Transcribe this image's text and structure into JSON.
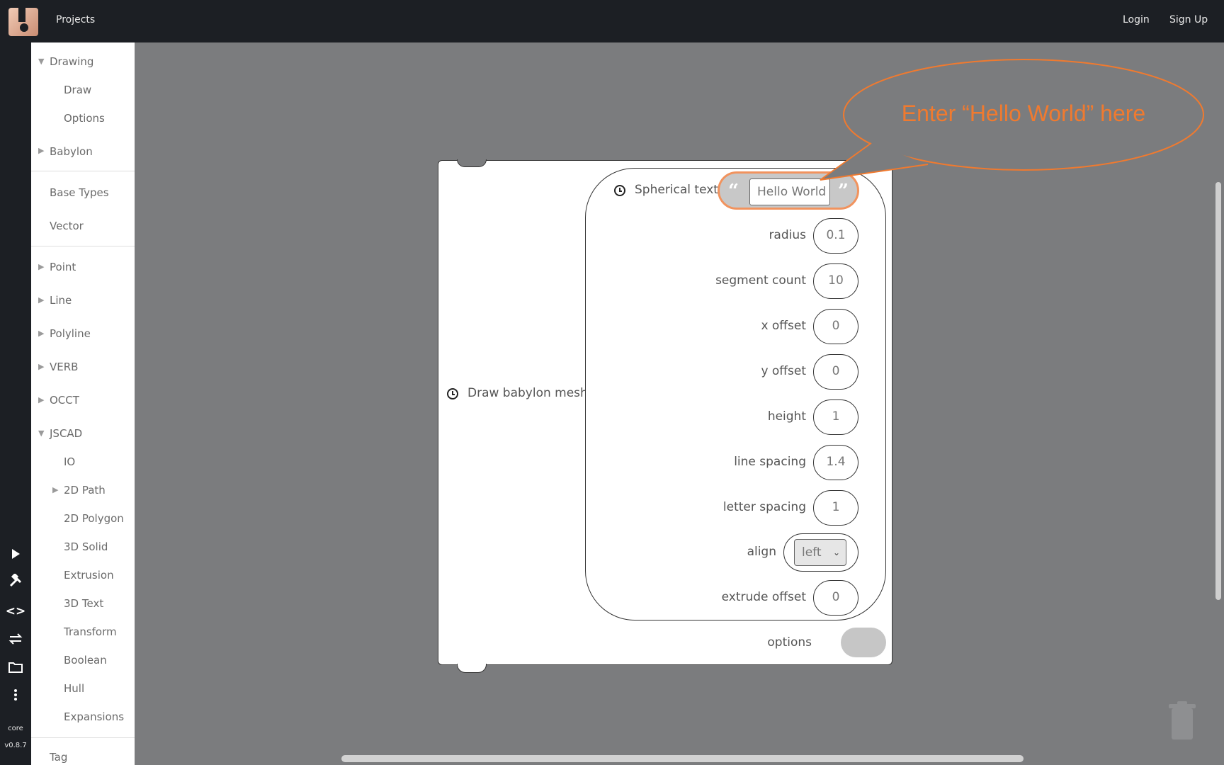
{
  "topbar": {
    "nav_projects": "Projects",
    "login": "Login",
    "signup": "Sign Up"
  },
  "rail": {
    "icons": [
      "play-icon",
      "tools-icon",
      "code-icon",
      "swap-icon",
      "folder-icon",
      "more-icon"
    ],
    "core": "core",
    "version": "v0.8.7"
  },
  "toolbox": {
    "items": [
      {
        "label": "Drawing",
        "expanded": true
      },
      {
        "label": "Draw"
      },
      {
        "label": "Options"
      },
      {
        "label": "Babylon",
        "expanded": false
      },
      {
        "label": "Base Types"
      },
      {
        "label": "Vector"
      },
      {
        "label": "Point",
        "expanded": false
      },
      {
        "label": "Line",
        "expanded": false
      },
      {
        "label": "Polyline",
        "expanded": false
      },
      {
        "label": "VERB",
        "expanded": false
      },
      {
        "label": "OCCT",
        "expanded": false
      },
      {
        "label": "JSCAD",
        "expanded": true
      },
      {
        "label": "IO"
      },
      {
        "label": "2D Path",
        "expanded": false
      },
      {
        "label": "2D Polygon"
      },
      {
        "label": "3D Solid"
      },
      {
        "label": "Extrusion"
      },
      {
        "label": "3D Text"
      },
      {
        "label": "Transform"
      },
      {
        "label": "Boolean"
      },
      {
        "label": "Hull"
      },
      {
        "label": "Expansions"
      },
      {
        "label": "Tag"
      }
    ]
  },
  "block": {
    "outer_label": "Draw babylon mesh",
    "inner_label": "Spherical text",
    "text_value": "Hello World",
    "params": [
      {
        "label": "radius",
        "value": "0.1"
      },
      {
        "label": "segment count",
        "value": "10"
      },
      {
        "label": "x offset",
        "value": "0"
      },
      {
        "label": "y offset",
        "value": "0"
      },
      {
        "label": "height",
        "value": "1"
      },
      {
        "label": "line spacing",
        "value": "1.4"
      },
      {
        "label": "letter spacing",
        "value": "1"
      },
      {
        "label": "align",
        "value": "left"
      },
      {
        "label": "extrude offset",
        "value": "0"
      }
    ],
    "options_label": "options"
  },
  "callout": {
    "text": "Enter “Hello World” here",
    "color": "#f07a2f"
  }
}
